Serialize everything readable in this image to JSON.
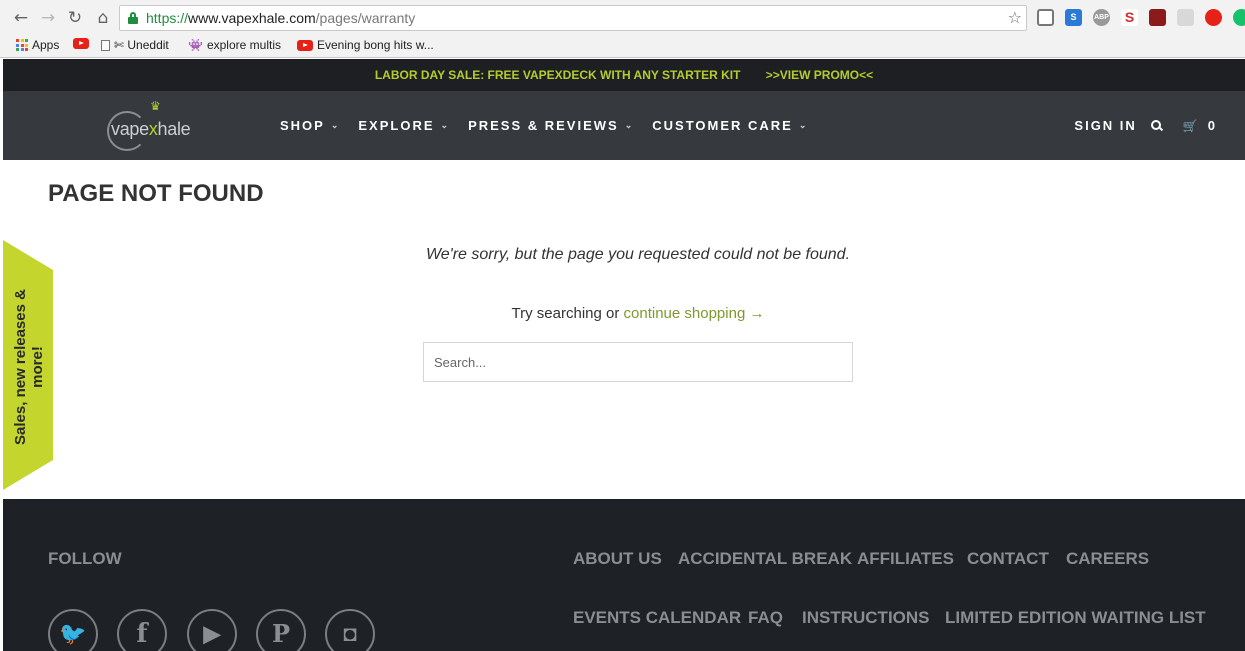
{
  "browser": {
    "back_glyph": "←",
    "forward_glyph": "→",
    "reload_glyph": "↻",
    "home_glyph": "⌂",
    "url_scheme": "https://",
    "url_host": "www.vapexhale.com",
    "url_path": "/pages/warranty",
    "bookmark_star": "☆",
    "bookmarks": [
      {
        "label": "Apps"
      },
      {
        "label": ""
      },
      {
        "label": "✄ Uneddit"
      },
      {
        "label": "explore multis"
      },
      {
        "label": "Evening bong hits w..."
      }
    ]
  },
  "promo": {
    "text": "LABOR DAY SALE: FREE VAPEXDECK WITH ANY STARTER KIT",
    "link": ">>VIEW PROMO<<"
  },
  "logo": {
    "prefix": "vape",
    "x": "x",
    "suffix": "hale"
  },
  "nav": {
    "items": [
      {
        "label": "SHOP"
      },
      {
        "label": "EXPLORE"
      },
      {
        "label": "PRESS & REVIEWS"
      },
      {
        "label": "CUSTOMER CARE"
      }
    ],
    "caret": "⌄",
    "sign_in": "SIGN IN",
    "cart_count": "0"
  },
  "main": {
    "title": "PAGE NOT FOUND",
    "message": "We're sorry, but the page you requested could not be found.",
    "try_text": "Try searching or ",
    "continue_link": "continue shopping →",
    "search_placeholder": "Search..."
  },
  "side_tab": {
    "line1": "Sales, new releases &",
    "line2": "more!"
  },
  "footer": {
    "follow": "FOLLOW",
    "links_row1": [
      "ABOUT US",
      "ACCIDENTAL BREAK",
      "AFFILIATES",
      "CONTACT",
      "CAREERS"
    ],
    "links_row2": [
      "EVENTS CALENDAR",
      "FAQ",
      "INSTRUCTIONS",
      "LIMITED EDITION WAITING LIST"
    ]
  },
  "colors": {
    "accent": "#b5cc2e",
    "nav_bg": "#36393e",
    "footer_bg": "#1e2125"
  }
}
